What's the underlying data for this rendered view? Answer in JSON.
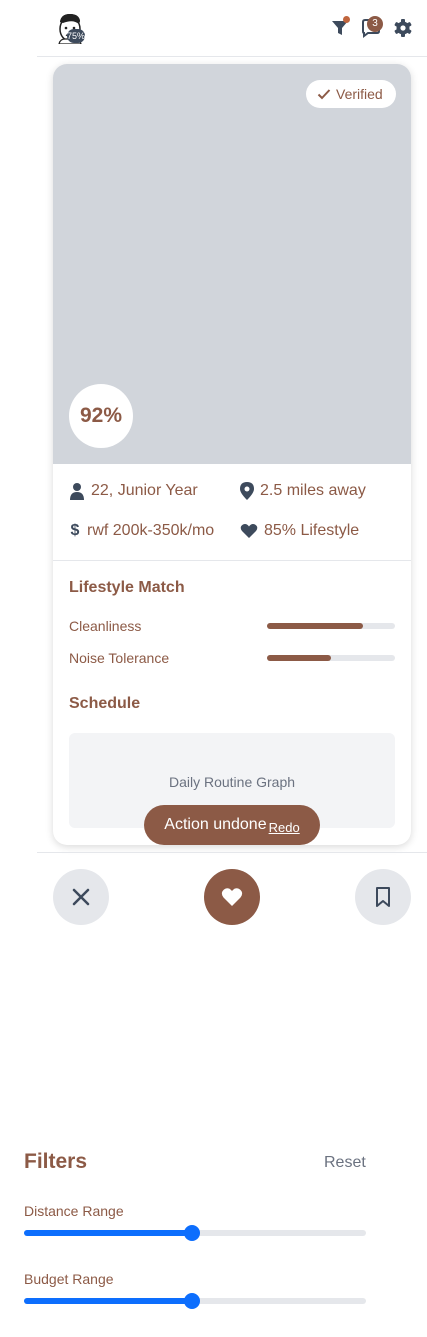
{
  "header": {
    "avatar_badge": "75%",
    "chat_badge": "3"
  },
  "card": {
    "verified_label": "Verified",
    "match_score": "92%",
    "info": {
      "age_year": "22, Junior Year",
      "distance": "2.5 miles away",
      "budget": "rwf 200k-350k/mo",
      "lifestyle": "85% Lifestyle"
    },
    "lifestyle_match": {
      "title": "Lifestyle Match",
      "items": [
        {
          "label": "Cleanliness",
          "value": 0.75
        },
        {
          "label": "Noise Tolerance",
          "value": 0.5
        }
      ]
    },
    "schedule": {
      "title": "Schedule",
      "graph_placeholder": "Daily Routine Graph"
    }
  },
  "toast": {
    "message": "Action undone",
    "action": "Redo"
  },
  "filters": {
    "title": "Filters",
    "reset_label": "Reset",
    "ranges": [
      {
        "label": "Distance Range",
        "value": 0.49
      },
      {
        "label": "Budget Range",
        "value": 0.49
      }
    ]
  },
  "colors": {
    "brand": "#8c5a46",
    "slider_accent": "#0d6efd",
    "photo_placeholder": "#d1d5db"
  }
}
